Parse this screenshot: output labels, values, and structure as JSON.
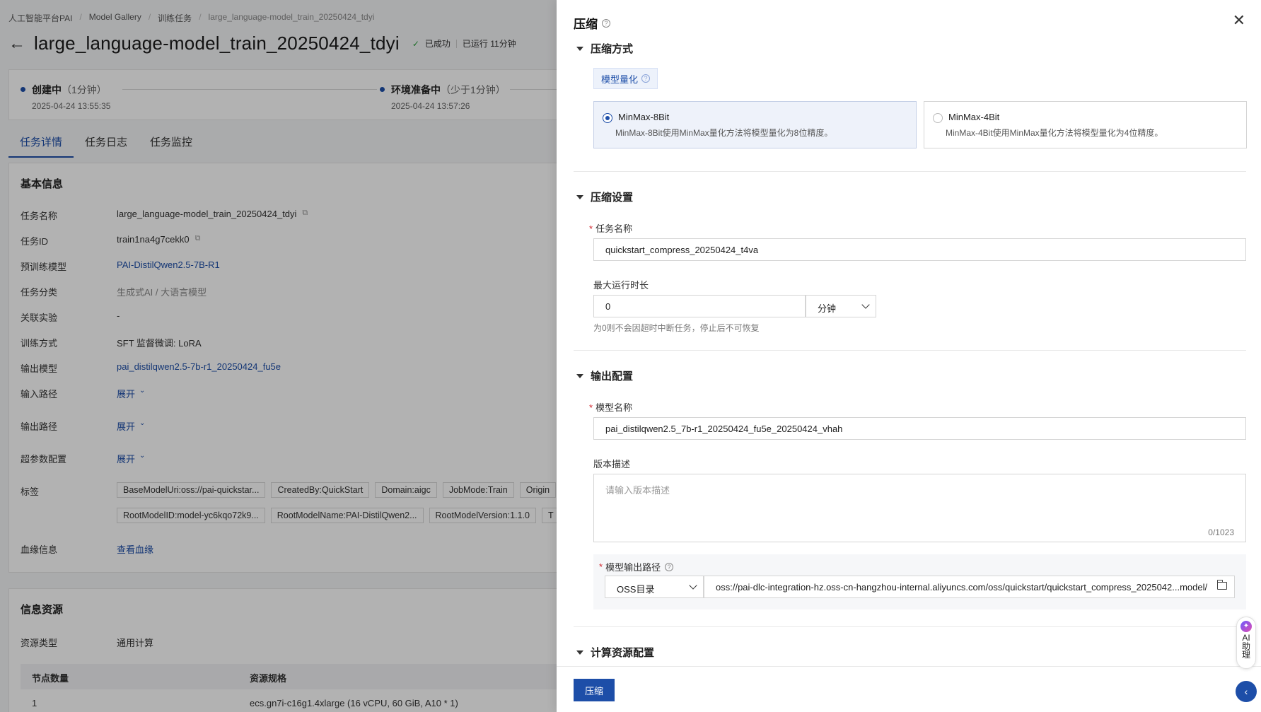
{
  "breadcrumb": [
    "人工智能平台PAI",
    "Model Gallery",
    "训练任务",
    "large_language-model_train_20250424_tdyi"
  ],
  "page": {
    "title": "large_language-model_train_20250424_tdyi",
    "status": "已成功",
    "runtime": "已运行 11分钟"
  },
  "steps": [
    {
      "title": "创建中",
      "sub": "（1分钟）",
      "time": "2025-04-24 13:55:35"
    },
    {
      "title": "环境准备中",
      "sub": "（少于1分钟）",
      "time": "2025-04-24 13:57:26"
    }
  ],
  "tabs": [
    "任务详情",
    "任务日志",
    "任务监控"
  ],
  "basic": {
    "title": "基本信息",
    "rows": [
      {
        "k": "任务名称",
        "v": "large_language-model_train_20250424_tdyi"
      },
      {
        "k": "任务ID",
        "v": "train1na4g7cekk0"
      },
      {
        "k": "预训练模型",
        "v": "PAI-DistilQwen2.5-7B-R1"
      },
      {
        "k": "任务分类",
        "v": "生成式AI / 大语言模型"
      },
      {
        "k": "关联实验",
        "v": "-"
      },
      {
        "k": "训练方式",
        "v": "SFT 监督微调: LoRA"
      },
      {
        "k": "输出模型",
        "v": "pai_distilqwen2.5-7b-r1_20250424_fu5e"
      },
      {
        "k": "输入路径",
        "v": "展开"
      },
      {
        "k": "输出路径",
        "v": "展开"
      },
      {
        "k": "超参数配置",
        "v": "展开"
      },
      {
        "k": "标签",
        "v": ""
      },
      {
        "k": "血缘信息",
        "v": "查看血缘"
      }
    ],
    "tags_row1": [
      "BaseModelUri:oss://pai-quickstar...",
      "CreatedBy:QuickStart",
      "Domain:aigc",
      "JobMode:Train",
      "Origin"
    ],
    "tags_row2": [
      "RootModelID:model-yc6kqo72k9...",
      "RootModelName:PAI-DistilQwen2...",
      "RootModelVersion:1.1.0",
      "T"
    ]
  },
  "resource": {
    "title": "信息资源",
    "type_label": "资源类型",
    "type_value": "通用计算",
    "col_nodes": "节点数量",
    "col_spec": "资源规格",
    "nodes": "1",
    "spec": "ecs.gn7i-c16g1.4xlarge (16 vCPU, 60 GiB, A10 * 1)"
  },
  "drawer": {
    "title": "压缩",
    "sec_method": "压缩方式",
    "chip": "模型量化",
    "options": [
      {
        "title": "MinMax-8Bit",
        "desc": "MinMax-8Bit使用MinMax量化方法将模型量化为8位精度。",
        "selected": true
      },
      {
        "title": "MinMax-4Bit",
        "desc": "MinMax-4Bit使用MinMax量化方法将模型量化为4位精度。",
        "selected": false
      }
    ],
    "sec_settings": "压缩设置",
    "task_name_label": "任务名称",
    "task_name_value": "quickstart_compress_20250424_t4va",
    "max_runtime_label": "最大运行时长",
    "max_runtime_value": "0",
    "max_runtime_unit": "分钟",
    "max_runtime_hint": "为0则不会因超时中断任务，停止后不可恢复",
    "sec_output": "输出配置",
    "model_name_label": "模型名称",
    "model_name_value": "pai_distilqwen2.5_7b-r1_20250424_fu5e_20250424_vhah",
    "version_desc_label": "版本描述",
    "version_desc_placeholder": "请输入版本描述",
    "version_desc_count": "0/1023",
    "output_path_label": "模型输出路径",
    "output_path_type": "OSS目录",
    "output_path_value": "oss://pai-dlc-integration-hz.oss-cn-hangzhou-internal.aliyuncs.com/oss/quickstart/quickstart_compress_2025042...model/",
    "sec_compute": "计算资源配置",
    "submit": "压缩"
  },
  "ai_helper": "AI助理",
  "colors": {
    "primary": "#1d4ea8",
    "success": "#2b9e3c",
    "required": "#d0242b"
  }
}
